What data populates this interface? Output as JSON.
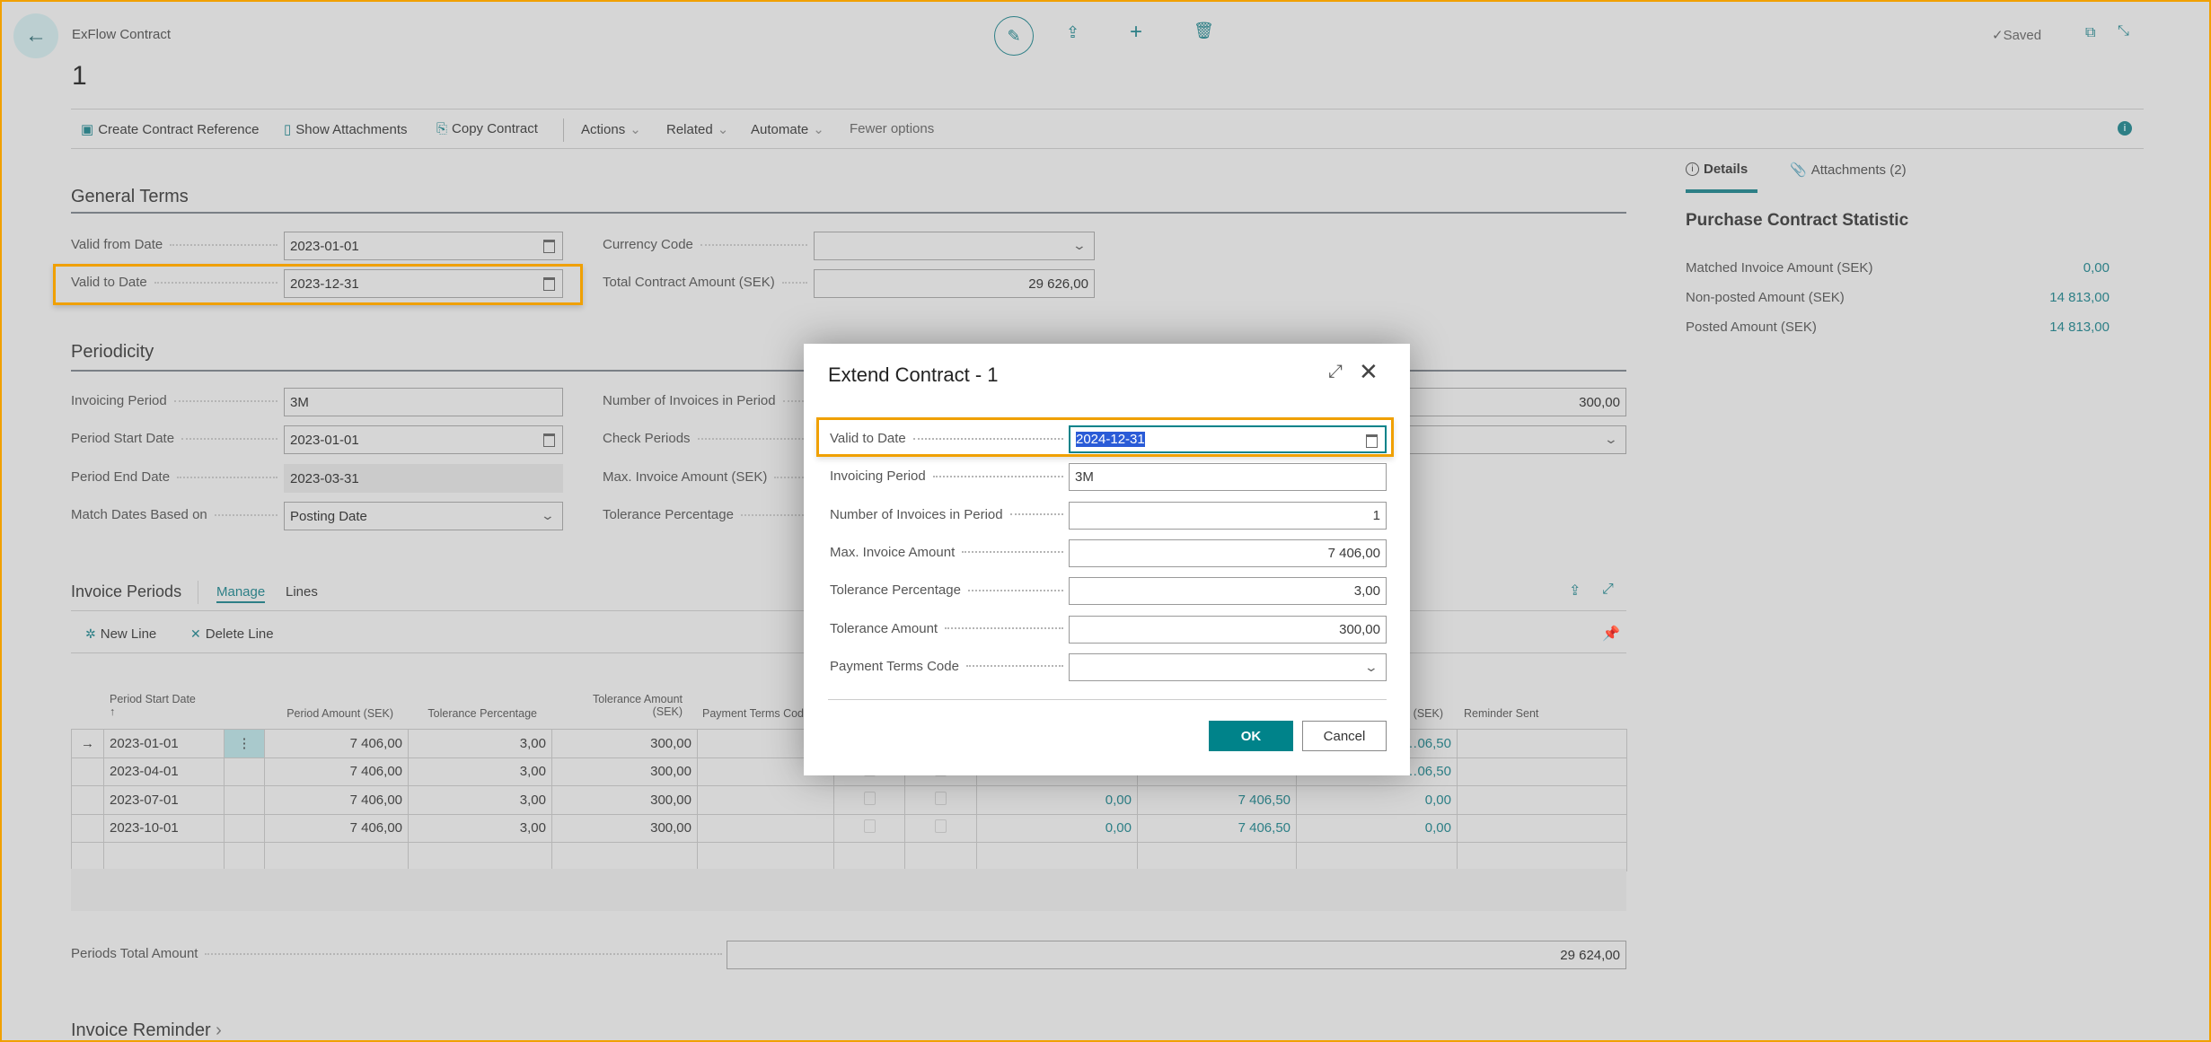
{
  "header": {
    "breadcrumb": "ExFlow Contract",
    "title": "1",
    "status": "Saved"
  },
  "actionbar": {
    "items": [
      "Create Contract Reference",
      "Show Attachments",
      "Copy Contract"
    ],
    "menus": [
      "Actions",
      "Related",
      "Automate"
    ],
    "fewer": "Fewer options"
  },
  "general": {
    "title": "General Terms",
    "valid_from_label": "Valid from Date",
    "valid_from": "2023-01-01",
    "valid_to_label": "Valid to Date",
    "valid_to": "2023-12-31",
    "currency_label": "Currency Code",
    "currency": "",
    "total_label": "Total Contract Amount (SEK)",
    "total": "29 626,00"
  },
  "periodicity": {
    "title": "Periodicity",
    "invoicing_period_label": "Invoicing Period",
    "invoicing_period": "3M",
    "start_label": "Period Start Date",
    "start": "2023-01-01",
    "end_label": "Period End Date",
    "end": "2023-03-31",
    "match_label": "Match Dates Based on",
    "match": "Posting Date",
    "num_label": "Number of Invoices in Period",
    "check_label": "Check Periods",
    "max_label": "Max. Invoice Amount (SEK)",
    "tol_label": "Tolerance Percentage",
    "tol_amount": "300,00"
  },
  "invoice_periods": {
    "title": "Invoice Periods",
    "tab_manage": "Manage",
    "tab_lines": "Lines",
    "new_line": "New Line",
    "delete_line": "Delete Line",
    "headers": {
      "start": "Period Start Date",
      "sort": "↑",
      "amount": "Period Amount (SEK)",
      "tol_pct": "Tolerance Percentage",
      "tol_amt_1": "Tolerance Amount",
      "tol_amt_2": "(SEK)",
      "terms": "Payment Terms Cod",
      "last_sek": "(SEK)",
      "reminder": "Reminder Sent"
    },
    "rows": [
      {
        "date": "2023-01-01",
        "amount": "7 406,00",
        "pct": "3,00",
        "tol": "300,00",
        "a": "",
        "b": "",
        "c": "…06,50"
      },
      {
        "date": "2023-04-01",
        "amount": "7 406,00",
        "pct": "3,00",
        "tol": "300,00",
        "a": "",
        "b": "",
        "c": "…06,50"
      },
      {
        "date": "2023-07-01",
        "amount": "7 406,00",
        "pct": "3,00",
        "tol": "300,00",
        "a": "0,00",
        "b": "7 406,50",
        "c": "0,00"
      },
      {
        "date": "2023-10-01",
        "amount": "7 406,00",
        "pct": "3,00",
        "tol": "300,00",
        "a": "0,00",
        "b": "7 406,50",
        "c": "0,00"
      }
    ],
    "total_label": "Periods Total Amount",
    "total": "29 624,00"
  },
  "reminder": {
    "title": "Invoice Reminder"
  },
  "factbox": {
    "tab_details": "Details",
    "tab_attachments": "Attachments (2)",
    "title": "Purchase Contract Statistic",
    "rows": [
      {
        "label": "Matched Invoice Amount (SEK)",
        "value": "0,00"
      },
      {
        "label": "Non-posted Amount (SEK)",
        "value": "14 813,00"
      },
      {
        "label": "Posted Amount (SEK)",
        "value": "14 813,00"
      }
    ]
  },
  "dialog": {
    "title": "Extend Contract - 1",
    "fields": [
      {
        "label": "Valid to Date",
        "value": "2024-12-31"
      },
      {
        "label": "Invoicing Period",
        "value": "3M"
      },
      {
        "label": "Number of Invoices in Period",
        "value": "1"
      },
      {
        "label": "Max. Invoice Amount",
        "value": "7 406,00"
      },
      {
        "label": "Tolerance Percentage",
        "value": "3,00"
      },
      {
        "label": "Tolerance Amount",
        "value": "300,00"
      },
      {
        "label": "Payment Terms Code",
        "value": ""
      }
    ],
    "ok": "OK",
    "cancel": "Cancel"
  },
  "colors": {
    "accent": "#00838a",
    "highlight": "#f0a000"
  }
}
